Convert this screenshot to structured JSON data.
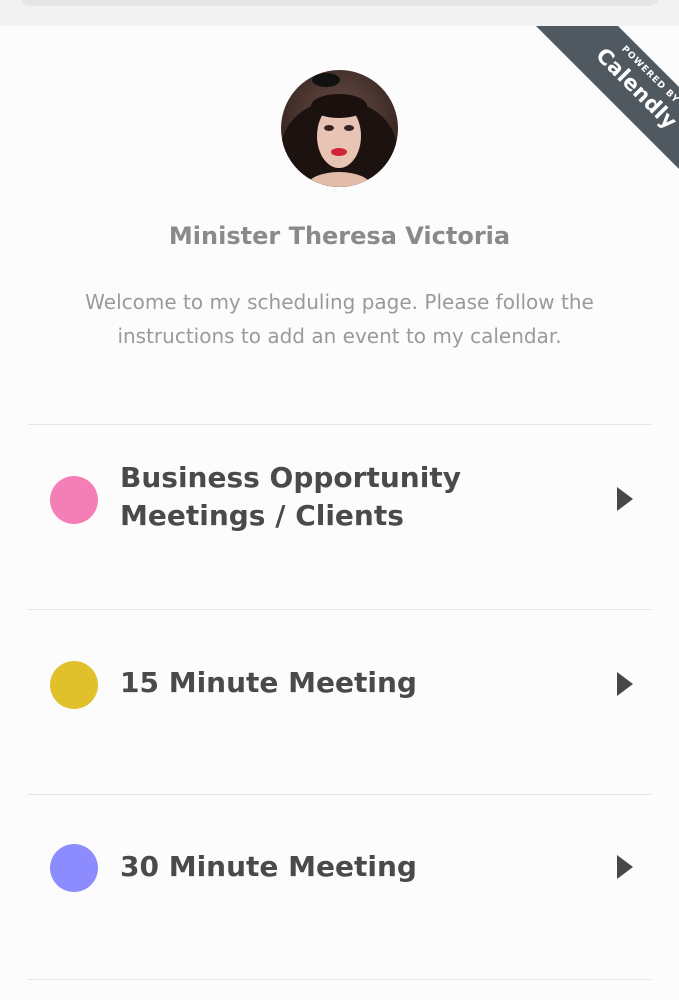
{
  "ribbon": {
    "powered_by": "POWERED BY",
    "brand": "Calendly"
  },
  "profile": {
    "name": "Minister Theresa Victoria",
    "welcome": "Welcome to my scheduling page. Please follow the instructions to add an event to my calendar."
  },
  "events": [
    {
      "title": "Business Opportunity Meetings / Clients",
      "color": "#f47fb6"
    },
    {
      "title": "15 Minute Meeting",
      "color": "#e0c12c"
    },
    {
      "title": "30 Minute Meeting",
      "color": "#8c8cff"
    }
  ]
}
